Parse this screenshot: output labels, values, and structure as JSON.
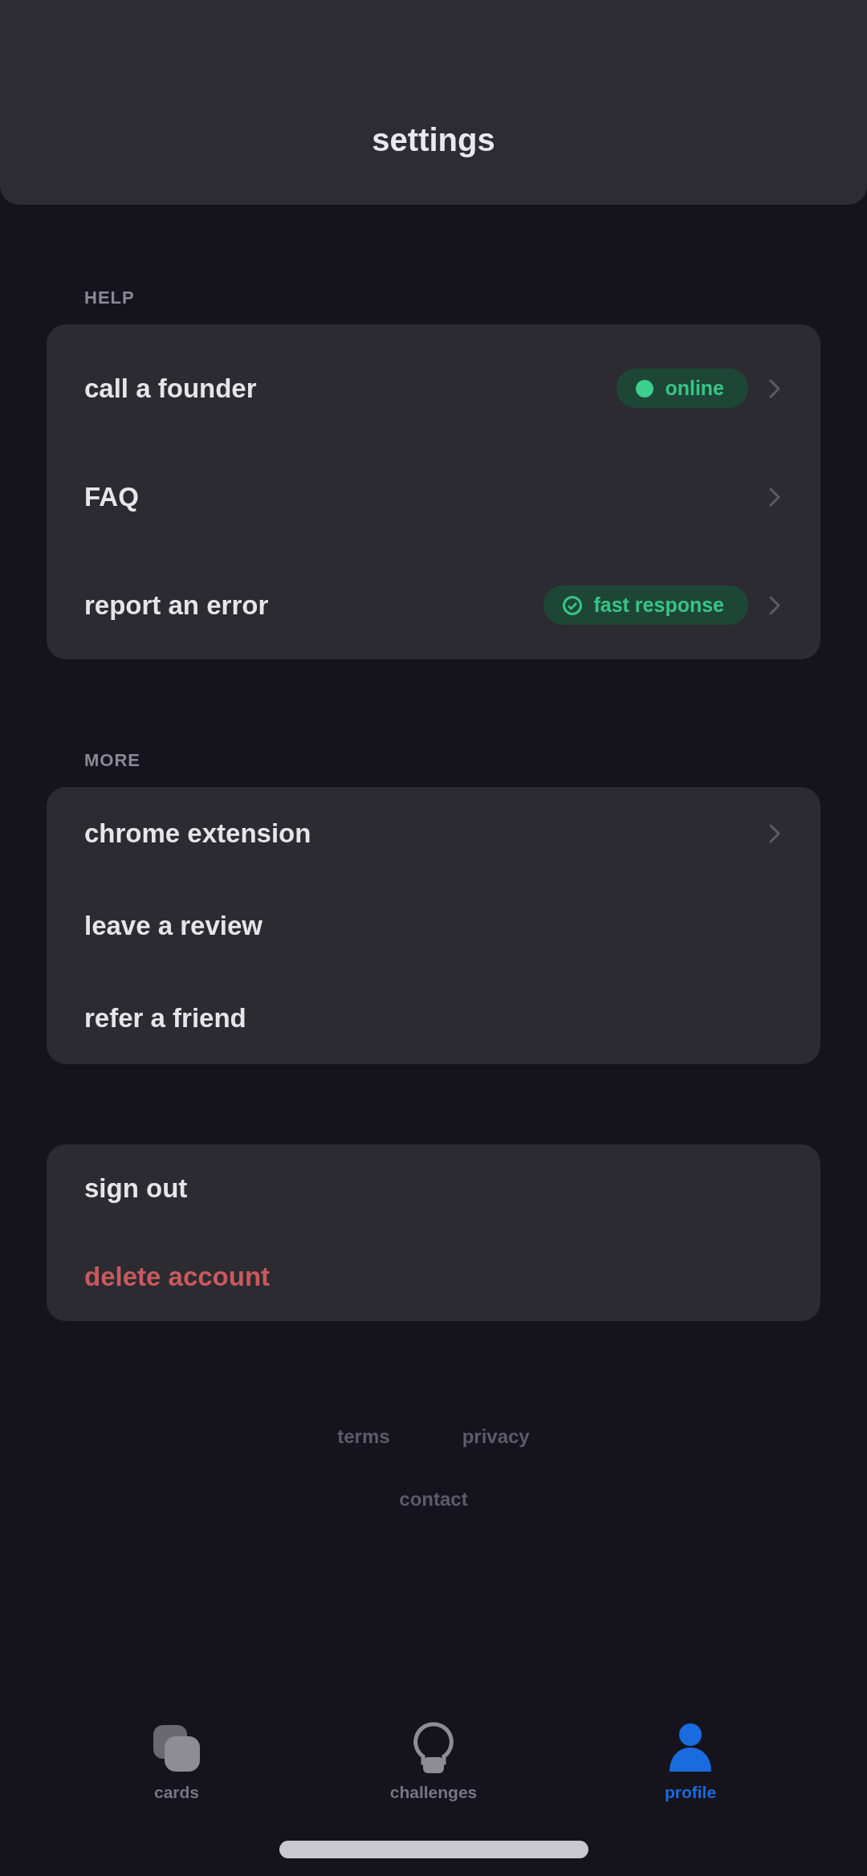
{
  "header": {
    "title": "settings"
  },
  "sections": [
    {
      "label": "HELP",
      "items": [
        {
          "label": "call a founder",
          "chevron": true,
          "badge": {
            "kind": "dot",
            "text": "online"
          }
        },
        {
          "label": "FAQ",
          "chevron": true
        },
        {
          "label": "report an error",
          "chevron": true,
          "badge": {
            "kind": "check",
            "text": "fast response"
          }
        }
      ]
    },
    {
      "label": "MORE",
      "items": [
        {
          "label": "chrome extension",
          "chevron": true
        },
        {
          "label": "leave a review",
          "chevron": false
        },
        {
          "label": "refer a friend",
          "chevron": false
        }
      ]
    },
    {
      "items": [
        {
          "label": "sign out",
          "chevron": false,
          "danger": false
        },
        {
          "label": "delete account",
          "chevron": false,
          "danger": true
        }
      ]
    }
  ],
  "footer": {
    "links": [
      "terms",
      "privacy"
    ],
    "bottom_link": "contact"
  },
  "tab_bar": [
    {
      "kind": "cards",
      "label": "cards",
      "selected": false
    },
    {
      "kind": "bulb",
      "label": "challenges",
      "selected": false
    },
    {
      "kind": "person",
      "label": "profile",
      "selected": true
    }
  ]
}
